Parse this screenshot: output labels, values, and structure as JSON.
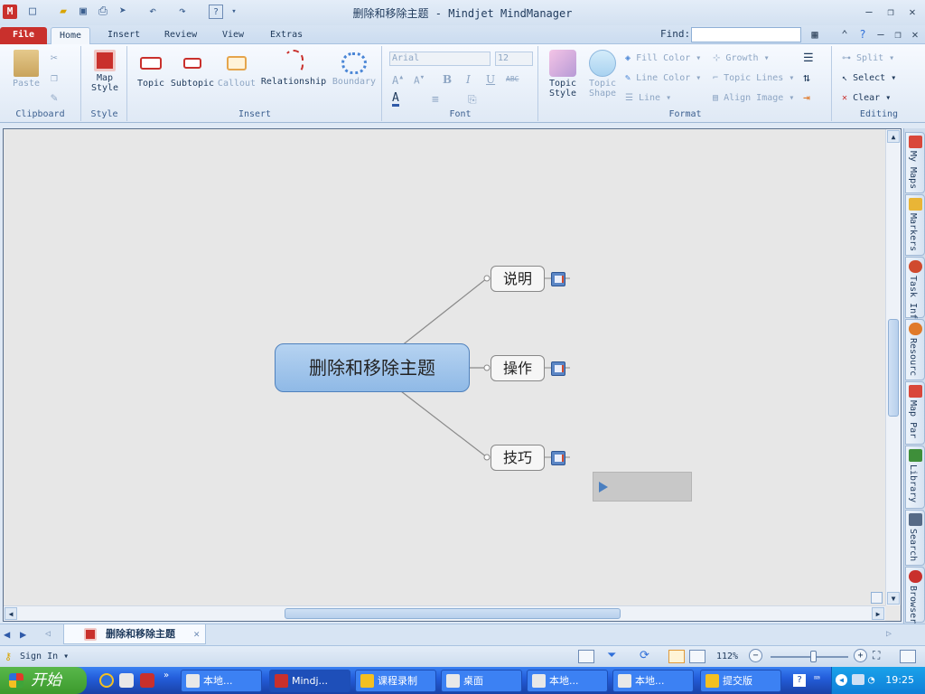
{
  "window": {
    "title": "删除和移除主题 - Mindjet MindManager"
  },
  "tabs": [
    {
      "label": "File"
    },
    {
      "label": "Home"
    },
    {
      "label": "Insert"
    },
    {
      "label": "Review"
    },
    {
      "label": "View"
    },
    {
      "label": "Extras"
    }
  ],
  "find": {
    "label": "Find:",
    "value": ""
  },
  "ribbon": {
    "clipboard": {
      "label": "Clipboard",
      "paste": "Paste"
    },
    "style": {
      "label": "Style",
      "map_style": "Map Style"
    },
    "insert": {
      "label": "Insert",
      "topic": "Topic",
      "subtopic": "Subtopic",
      "callout": "Callout",
      "relationship": "Relationship",
      "boundary": "Boundary"
    },
    "font": {
      "label": "Font",
      "font_name": "Arial",
      "font_size": "12",
      "bold": "B",
      "italic": "I",
      "underline": "U",
      "strike": "ABC"
    },
    "format": {
      "label": "Format",
      "topic_style": "Topic Style",
      "topic_shape": "Topic Shape",
      "fill_color": "Fill Color",
      "line_color": "Line Color",
      "line": "Line",
      "growth": "Growth",
      "topic_lines": "Topic Lines",
      "align_image": "Align Image"
    },
    "editing": {
      "label": "Editing",
      "split": "Split",
      "select": "Select",
      "clear": "Clear"
    }
  },
  "map": {
    "central_topic": "删除和移除主题",
    "subtopics": [
      {
        "label": "说明"
      },
      {
        "label": "操作"
      },
      {
        "label": "技巧"
      }
    ]
  },
  "sidebar": {
    "tabs": [
      {
        "label": "My Maps",
        "color": "#d9473a"
      },
      {
        "label": "Markers",
        "color": "#e9b536"
      },
      {
        "label": "Task Inf",
        "color": "#d04a2e"
      },
      {
        "label": "Resourc",
        "color": "#e07a2a"
      },
      {
        "label": "Map Par",
        "color": "#d9473a"
      },
      {
        "label": "Library",
        "color": "#3e8f3a"
      },
      {
        "label": "Search",
        "color": "#566a86"
      },
      {
        "label": "Browser",
        "color": "#c9302c"
      }
    ]
  },
  "document_tab": {
    "label": "删除和移除主题"
  },
  "status": {
    "sign_in": "Sign In",
    "zoom": "112%",
    "zoom_level": 0.55
  },
  "taskbar": {
    "start": "开始",
    "items": [
      {
        "label": "本地...",
        "active": false
      },
      {
        "label": "Mindj...",
        "active": true
      },
      {
        "label": "课程录制",
        "active": false
      },
      {
        "label": "桌面",
        "active": false
      },
      {
        "label": "本地...",
        "active": false
      },
      {
        "label": "本地...",
        "active": false
      },
      {
        "label": "提交版",
        "active": false
      }
    ],
    "clock": "19:25"
  },
  "colors": {
    "file_tab": "#c9302c",
    "central_fill": "#9cc3ec",
    "central_border": "#4f81bd",
    "canvas_bg": "#e7e7e7",
    "taskbar": "#245edb",
    "start_button": "#3c9a2d"
  }
}
